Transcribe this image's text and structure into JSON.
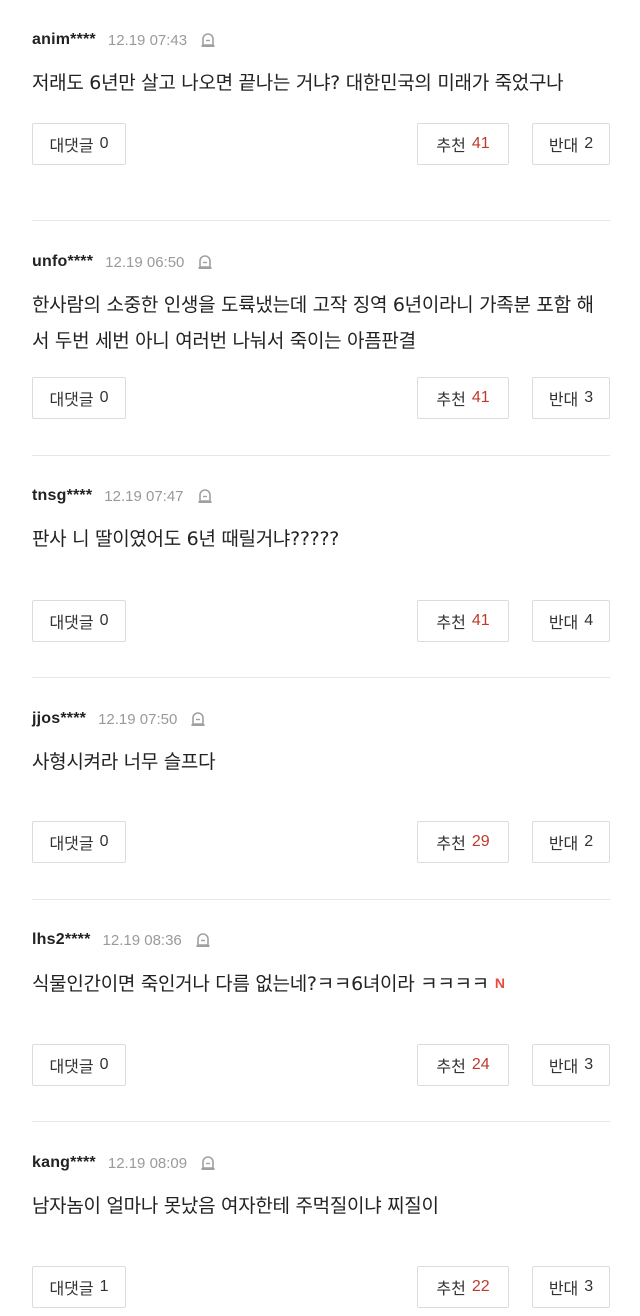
{
  "labels": {
    "reply": "대댓글",
    "like": "추천",
    "dislike": "반대",
    "new_badge": "N"
  },
  "comments": [
    {
      "nick": "anim****",
      "date": "12.19 07:43",
      "text": "저래도 6년만 살고 나오면 끝나는 거냐? 대한민국의 미래가 죽었구나",
      "replies": "0",
      "likes": "41",
      "dislikes": "2"
    },
    {
      "nick": "unfo****",
      "date": "12.19 06:50",
      "text": "한사람의 소중한 인생을 도륙냈는데 고작 징역 6년이라니 가족분 포함 해서 두번 세번 아니 여러번 나눠서 죽이는 아픔판결",
      "replies": "0",
      "likes": "41",
      "dislikes": "3"
    },
    {
      "nick": "tnsg****",
      "date": "12.19 07:47",
      "text": "판사 니 딸이였어도 6년 때릴거냐?????",
      "replies": "0",
      "likes": "41",
      "dislikes": "4"
    },
    {
      "nick": "jjos****",
      "date": "12.19 07:50",
      "text": "사형시켜라 너무 슬프다",
      "replies": "0",
      "likes": "29",
      "dislikes": "2"
    },
    {
      "nick": "lhs2****",
      "date": "12.19 08:36",
      "text": "식물인간이면 죽인거나 다름 없는네?ㅋㅋ6녀이라 ㅋㅋㅋㅋ",
      "is_new": true,
      "replies": "0",
      "likes": "24",
      "dislikes": "3"
    },
    {
      "nick": "kang****",
      "date": "12.19 08:09",
      "text": "남자놈이 얼마나 못났음 여자한테 주먹질이냐 찌질이",
      "replies": "1",
      "likes": "22",
      "dislikes": "3"
    }
  ]
}
